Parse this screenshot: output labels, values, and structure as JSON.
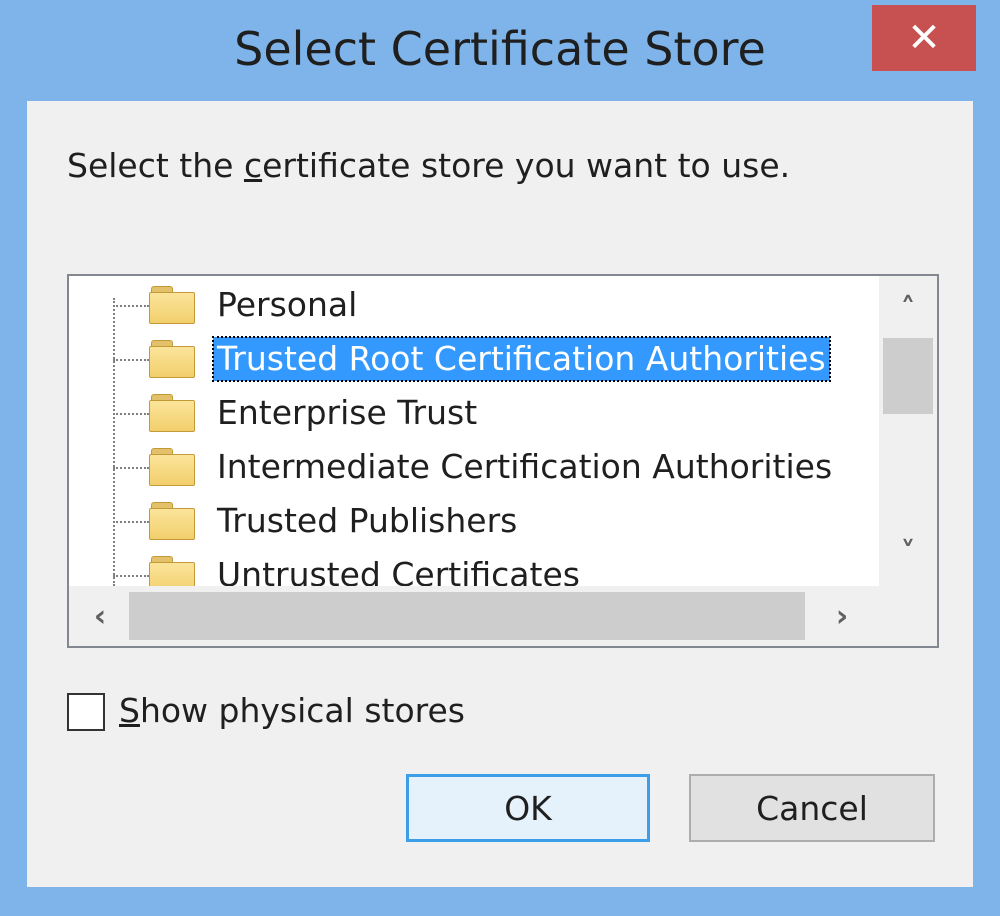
{
  "window": {
    "title": "Select Certificate Store",
    "close_label": "✕"
  },
  "dialog": {
    "prompt_before": "Select the ",
    "prompt_mnemonic": "c",
    "prompt_after": "ertificate store you want to use."
  },
  "tree": {
    "items": [
      {
        "label": "Personal",
        "selected": false
      },
      {
        "label": "Trusted Root Certification Authorities",
        "selected": true
      },
      {
        "label": "Enterprise Trust",
        "selected": false
      },
      {
        "label": "Intermediate Certification Authorities",
        "selected": false
      },
      {
        "label": "Trusted Publishers",
        "selected": false
      },
      {
        "label": "Untrusted Certificates",
        "selected": false
      }
    ]
  },
  "scroll": {
    "up": "˄",
    "down": "˅",
    "left": "‹",
    "right": "›"
  },
  "checkbox": {
    "mnemonic": "S",
    "label_rest": "how physical stores",
    "checked": false
  },
  "buttons": {
    "ok": "OK",
    "cancel": "Cancel"
  }
}
